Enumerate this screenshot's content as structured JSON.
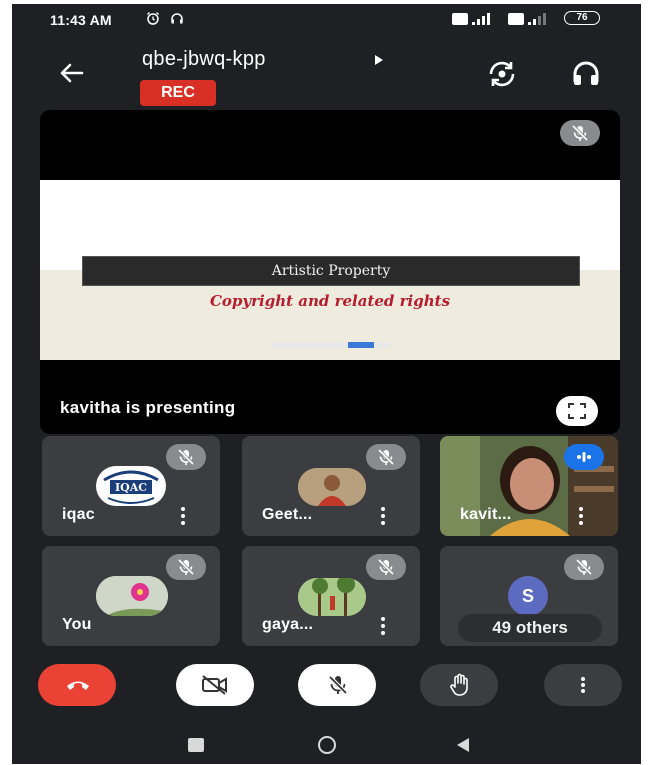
{
  "status_bar": {
    "time": "11:43 AM",
    "battery": "76",
    "icons": [
      "alarm-icon",
      "headset-icon",
      "volte-signal-icon",
      "volte-signal-icon"
    ]
  },
  "header": {
    "meeting_code": "qbe-jbwq-kpp",
    "recording_badge": "REC",
    "icons": [
      "back-arrow-icon",
      "caret-right-icon",
      "flip-camera-icon",
      "headphones-icon"
    ]
  },
  "presentation": {
    "slide_heading": "Artistic Property",
    "slide_subtitle": "Copyright and related rights",
    "presenter_label": "kavitha is presenting",
    "icons": [
      "mic-off-icon",
      "fullscreen-icon"
    ]
  },
  "participants": [
    {
      "name": "iqac",
      "avatar_text": "IQAC",
      "muted": true
    },
    {
      "name": "Geet...",
      "muted": true
    },
    {
      "name": "kavit...",
      "speaking": true
    },
    {
      "name": "You",
      "muted": true
    },
    {
      "name": "gaya...",
      "muted": true
    },
    {
      "name": "49 others",
      "avatar_letter": "S",
      "muted": true
    }
  ],
  "controls": {
    "icons": [
      "end-call-icon",
      "camera-off-icon",
      "mic-off-icon",
      "raise-hand-icon",
      "more-options-icon"
    ]
  },
  "colors": {
    "background": "#1f2023",
    "tile": "#3c3d41",
    "rec_red": "#d93025",
    "end_call": "#ea4335",
    "mute_badge": "#8a8b8e",
    "speaking_blue": "#1a73e8"
  }
}
